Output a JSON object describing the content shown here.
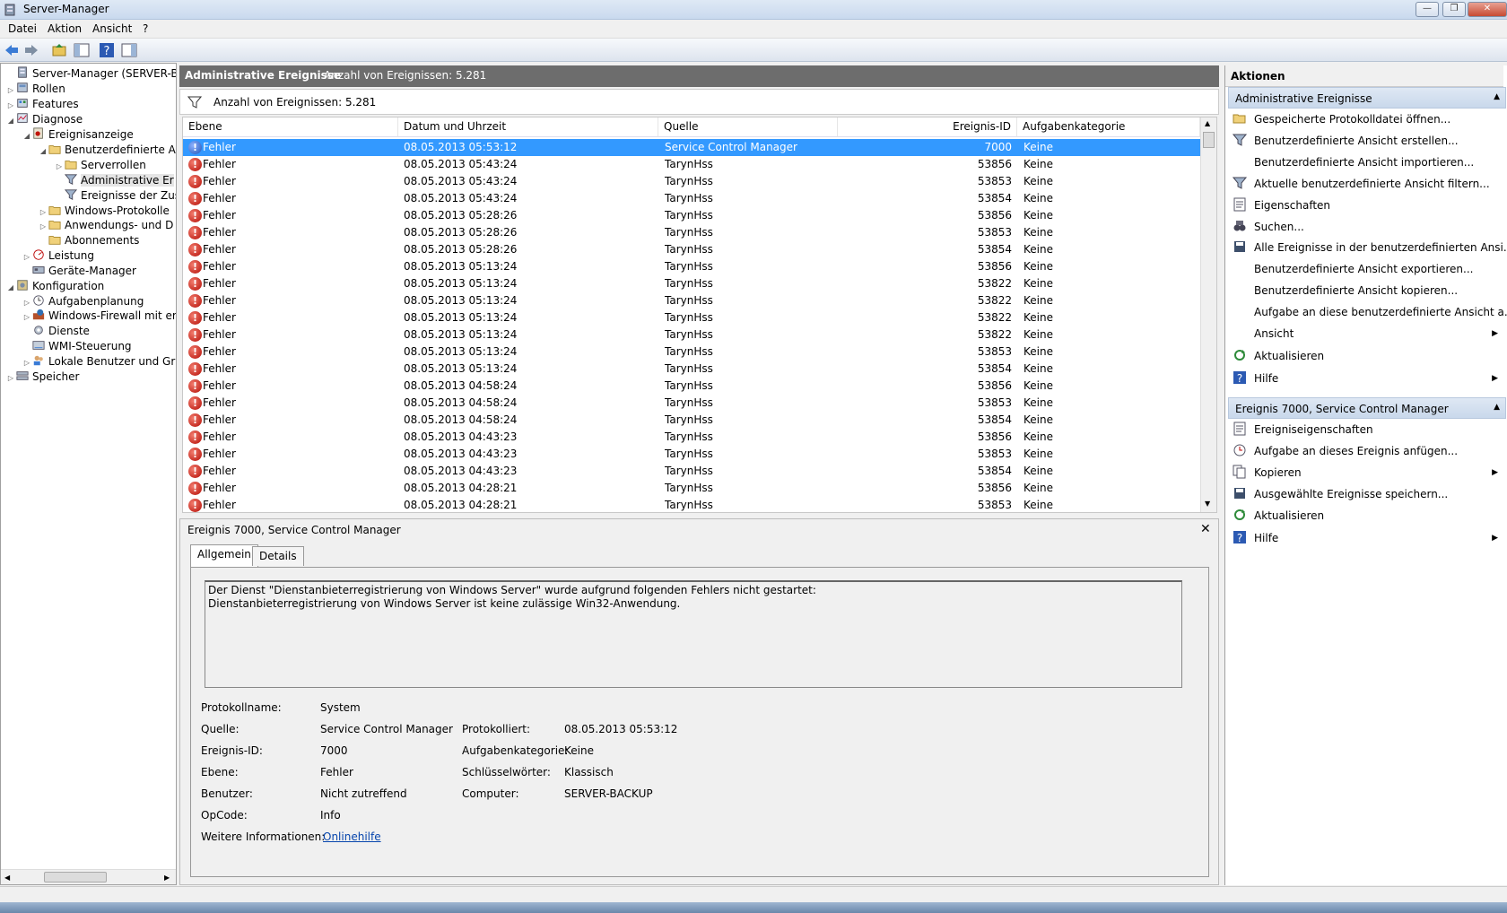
{
  "window": {
    "title": "Server-Manager",
    "min": "—",
    "max": "❐",
    "close": "✕"
  },
  "menu": [
    "Datei",
    "Aktion",
    "Ansicht",
    "?"
  ],
  "tree": [
    {
      "label": "Server-Manager (SERVER-BACKU",
      "icon": "server-icon",
      "level": 0,
      "exp": ""
    },
    {
      "label": "Rollen",
      "icon": "roles-icon",
      "level": 1,
      "exp": "▷"
    },
    {
      "label": "Features",
      "icon": "features-icon",
      "level": 1,
      "exp": "▷"
    },
    {
      "label": "Diagnose",
      "icon": "diagnose-icon",
      "level": 1,
      "exp": "◢"
    },
    {
      "label": "Ereignisanzeige",
      "icon": "eventviewer-icon",
      "level": 2,
      "exp": "◢"
    },
    {
      "label": "Benutzerdefinierte Ar",
      "icon": "folder-icon",
      "level": 3,
      "exp": "◢"
    },
    {
      "label": "Serverrollen",
      "icon": "folder-icon",
      "level": 4,
      "exp": "▷"
    },
    {
      "label": "Administrative Er",
      "icon": "filter-icon",
      "level": 4,
      "exp": "",
      "selected": true
    },
    {
      "label": "Ereignisse der Zus",
      "icon": "filter-icon",
      "level": 4,
      "exp": ""
    },
    {
      "label": "Windows-Protokolle",
      "icon": "folder-icon",
      "level": 3,
      "exp": "▷"
    },
    {
      "label": "Anwendungs- und D",
      "icon": "folder-icon",
      "level": 3,
      "exp": "▷"
    },
    {
      "label": "Abonnements",
      "icon": "folder-icon",
      "level": 3,
      "exp": ""
    },
    {
      "label": "Leistung",
      "icon": "performance-icon",
      "level": 2,
      "exp": "▷"
    },
    {
      "label": "Geräte-Manager",
      "icon": "device-manager-icon",
      "level": 2,
      "exp": ""
    },
    {
      "label": "Konfiguration",
      "icon": "config-icon",
      "level": 1,
      "exp": "◢"
    },
    {
      "label": "Aufgabenplanung",
      "icon": "clock-icon",
      "level": 2,
      "exp": "▷"
    },
    {
      "label": "Windows-Firewall mit er",
      "icon": "firewall-icon",
      "level": 2,
      "exp": "▷"
    },
    {
      "label": "Dienste",
      "icon": "services-icon",
      "level": 2,
      "exp": ""
    },
    {
      "label": "WMI-Steuerung",
      "icon": "wmi-icon",
      "level": 2,
      "exp": ""
    },
    {
      "label": "Lokale Benutzer und Gru",
      "icon": "users-icon",
      "level": 2,
      "exp": "▷"
    },
    {
      "label": "Speicher",
      "icon": "storage-icon",
      "level": 1,
      "exp": "▷"
    }
  ],
  "main": {
    "header_title": "Administrative Ereignisse",
    "header_count": "Anzahl von Ereignissen: 5.281",
    "filter_label": "Anzahl von Ereignissen: 5.281",
    "columns": [
      "Ebene",
      "Datum und Uhrzeit",
      "Quelle",
      "Ereignis-ID",
      "Aufgabenkategorie"
    ],
    "rows": [
      [
        "Fehler",
        "08.05.2013 05:53:12",
        "Service Control Manager",
        "7000",
        "Keine"
      ],
      [
        "Fehler",
        "08.05.2013 05:43:24",
        "TarynHss",
        "53856",
        "Keine"
      ],
      [
        "Fehler",
        "08.05.2013 05:43:24",
        "TarynHss",
        "53853",
        "Keine"
      ],
      [
        "Fehler",
        "08.05.2013 05:43:24",
        "TarynHss",
        "53854",
        "Keine"
      ],
      [
        "Fehler",
        "08.05.2013 05:28:26",
        "TarynHss",
        "53856",
        "Keine"
      ],
      [
        "Fehler",
        "08.05.2013 05:28:26",
        "TarynHss",
        "53853",
        "Keine"
      ],
      [
        "Fehler",
        "08.05.2013 05:28:26",
        "TarynHss",
        "53854",
        "Keine"
      ],
      [
        "Fehler",
        "08.05.2013 05:13:24",
        "TarynHss",
        "53856",
        "Keine"
      ],
      [
        "Fehler",
        "08.05.2013 05:13:24",
        "TarynHss",
        "53822",
        "Keine"
      ],
      [
        "Fehler",
        "08.05.2013 05:13:24",
        "TarynHss",
        "53822",
        "Keine"
      ],
      [
        "Fehler",
        "08.05.2013 05:13:24",
        "TarynHss",
        "53822",
        "Keine"
      ],
      [
        "Fehler",
        "08.05.2013 05:13:24",
        "TarynHss",
        "53822",
        "Keine"
      ],
      [
        "Fehler",
        "08.05.2013 05:13:24",
        "TarynHss",
        "53853",
        "Keine"
      ],
      [
        "Fehler",
        "08.05.2013 05:13:24",
        "TarynHss",
        "53854",
        "Keine"
      ],
      [
        "Fehler",
        "08.05.2013 04:58:24",
        "TarynHss",
        "53856",
        "Keine"
      ],
      [
        "Fehler",
        "08.05.2013 04:58:24",
        "TarynHss",
        "53853",
        "Keine"
      ],
      [
        "Fehler",
        "08.05.2013 04:58:24",
        "TarynHss",
        "53854",
        "Keine"
      ],
      [
        "Fehler",
        "08.05.2013 04:43:23",
        "TarynHss",
        "53856",
        "Keine"
      ],
      [
        "Fehler",
        "08.05.2013 04:43:23",
        "TarynHss",
        "53853",
        "Keine"
      ],
      [
        "Fehler",
        "08.05.2013 04:43:23",
        "TarynHss",
        "53854",
        "Keine"
      ],
      [
        "Fehler",
        "08.05.2013 04:28:21",
        "TarynHss",
        "53856",
        "Keine"
      ],
      [
        "Fehler",
        "08.05.2013 04:28:21",
        "TarynHss",
        "53853",
        "Keine"
      ]
    ]
  },
  "detail": {
    "title": "Ereignis 7000, Service Control Manager",
    "close": "✕",
    "tabs": [
      "Allgemein",
      "Details"
    ],
    "description": "Der Dienst \"Dienstanbieterregistrierung von Windows Server\" wurde aufgrund folgenden Fehlers nicht gestartet:\nDienstanbieterregistrierung von Windows Server ist keine zulässige Win32-Anwendung.",
    "fields": {
      "protokollname_label": "Protokollname:",
      "protokollname": "System",
      "quelle_label": "Quelle:",
      "quelle": "Service Control Manager",
      "protokolliert_label": "Protokolliert:",
      "protokolliert": "08.05.2013 05:53:12",
      "ereignisid_label": "Ereignis-ID:",
      "ereignisid": "7000",
      "aufgabenkategorie_label": "Aufgabenkategorie:",
      "aufgabenkategorie": "Keine",
      "ebene_label": "Ebene:",
      "ebene": "Fehler",
      "schluesselwoerter_label": "Schlüsselwörter:",
      "schluesselwoerter": "Klassisch",
      "benutzer_label": "Benutzer:",
      "benutzer": "Nicht zutreffend",
      "computer_label": "Computer:",
      "computer": "SERVER-BACKUP",
      "opcode_label": "OpCode:",
      "opcode": "Info",
      "weitere_label": "Weitere Informationen:",
      "weitere_link": "Onlinehilfe"
    }
  },
  "actions": {
    "title": "Aktionen",
    "section1": "Administrative Ereignisse",
    "items1": [
      {
        "label": "Gespeicherte Protokolldatei öffnen...",
        "icon": "open-folder-icon"
      },
      {
        "label": "Benutzerdefinierte Ansicht erstellen...",
        "icon": "filter-icon"
      },
      {
        "label": "Benutzerdefinierte Ansicht importieren...",
        "icon": ""
      },
      {
        "label": "Aktuelle benutzerdefinierte Ansicht filtern...",
        "icon": "filter-icon"
      },
      {
        "label": "Eigenschaften",
        "icon": "properties-icon"
      },
      {
        "label": "Suchen...",
        "icon": "binoculars-icon"
      },
      {
        "label": "Alle Ereignisse in der benutzerdefinierten Ansi...",
        "icon": "save-icon"
      },
      {
        "label": "Benutzerdefinierte Ansicht exportieren...",
        "icon": ""
      },
      {
        "label": "Benutzerdefinierte Ansicht kopieren...",
        "icon": ""
      },
      {
        "label": "Aufgabe an diese benutzerdefinierte Ansicht a...",
        "icon": ""
      },
      {
        "label": "Ansicht",
        "icon": "",
        "submenu": true
      },
      {
        "label": "Aktualisieren",
        "icon": "refresh-icon"
      },
      {
        "label": "Hilfe",
        "icon": "help-icon",
        "submenu": true
      }
    ],
    "section2": "Ereignis 7000, Service Control Manager",
    "items2": [
      {
        "label": "Ereigniseigenschaften",
        "icon": "properties-icon"
      },
      {
        "label": "Aufgabe an dieses Ereignis anfügen...",
        "icon": "task-icon"
      },
      {
        "label": "Kopieren",
        "icon": "copy-icon",
        "submenu": true
      },
      {
        "label": "Ausgewählte Ereignisse speichern...",
        "icon": "save-icon"
      },
      {
        "label": "Aktualisieren",
        "icon": "refresh-icon"
      },
      {
        "label": "Hilfe",
        "icon": "help-icon",
        "submenu": true
      }
    ]
  },
  "colors": {
    "selection": "#3399ff",
    "error": "#c0140a",
    "header_dark": "#6d6d6d",
    "section_bg": "#d2dfee"
  }
}
